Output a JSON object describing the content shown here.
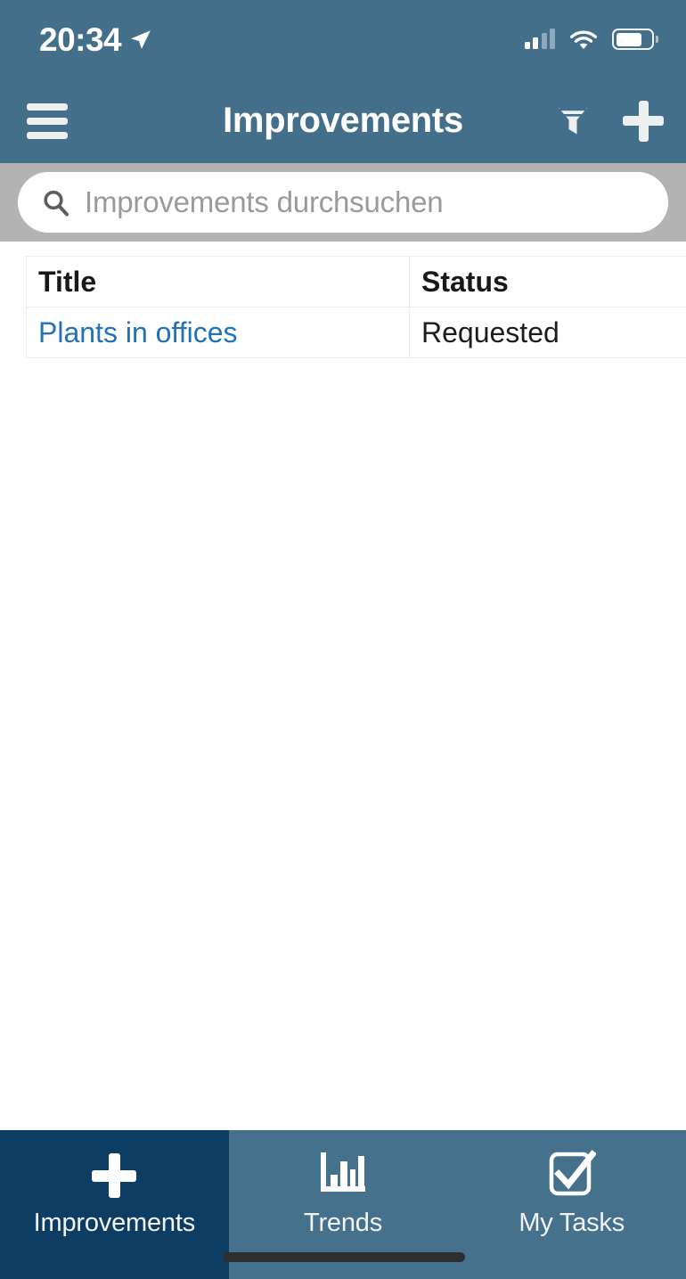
{
  "status_bar": {
    "time": "20:34",
    "location_icon": "location-arrow-icon",
    "signal_icon": "cellular-signal-icon",
    "signal_bars_filled": 2,
    "signal_bars_total": 4,
    "wifi_icon": "wifi-icon",
    "battery_icon": "battery-icon",
    "battery_level_percent": 72
  },
  "nav_bar": {
    "menu_icon": "hamburger-menu-icon",
    "title": "Improvements",
    "filter_icon": "filter-funnel-icon",
    "add_icon": "plus-icon",
    "background_color": "#446F8A"
  },
  "search": {
    "icon": "search-icon",
    "placeholder": "Improvements durchsuchen",
    "value": "",
    "strip_color": "#B3B3B3"
  },
  "table": {
    "columns": [
      "Title",
      "Status"
    ],
    "rows": [
      {
        "title": "Plants in offices",
        "status": "Requested"
      }
    ],
    "link_color": "#2272B8"
  },
  "tab_bar": {
    "active_index": 0,
    "active_color": "#0E3D63",
    "inactive_color": "#45718C",
    "items": [
      {
        "label": "Improvements",
        "icon": "plus-icon"
      },
      {
        "label": "Trends",
        "icon": "bar-chart-icon"
      },
      {
        "label": "My Tasks",
        "icon": "checkbox-check-icon"
      }
    ]
  }
}
